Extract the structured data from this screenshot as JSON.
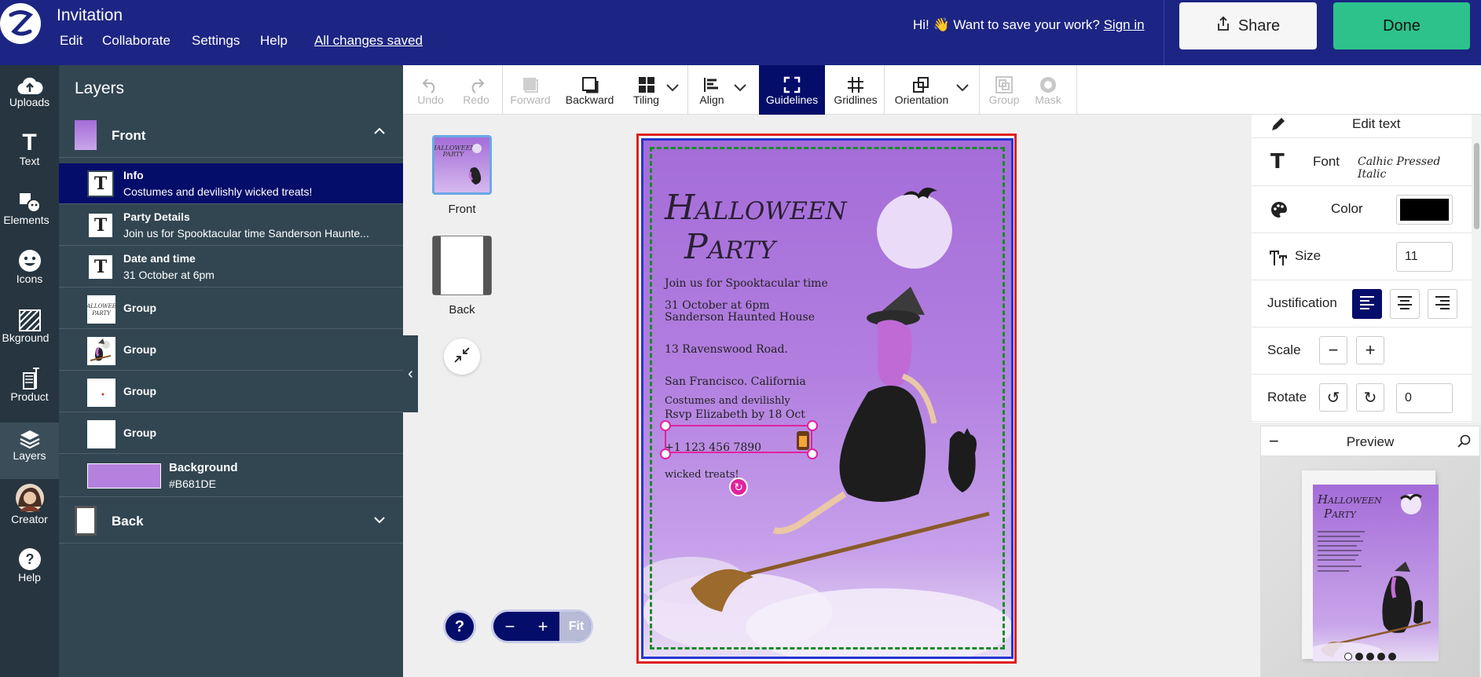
{
  "app": {
    "title": "Invitation",
    "menu": [
      "Edit",
      "Collaborate",
      "Settings",
      "Help"
    ],
    "saved_status": "All changes saved",
    "greeting": "Hi! 👋 Want to save your work?",
    "sign_in": "Sign in",
    "share_label": "Share",
    "done_label": "Done"
  },
  "left_nav": {
    "items": [
      {
        "label": "Uploads",
        "icon": "cloud-upload-icon"
      },
      {
        "label": "Text",
        "icon": "text-icon"
      },
      {
        "label": "Elements",
        "icon": "shapes-icon"
      },
      {
        "label": "Icons",
        "icon": "smiley-icon"
      },
      {
        "label": "Bkground",
        "icon": "hatch-icon"
      },
      {
        "label": "Product",
        "icon": "product-icon"
      },
      {
        "label": "Layers",
        "icon": "layers-icon"
      },
      {
        "label": "Creator",
        "icon": "avatar-icon"
      },
      {
        "label": "Help",
        "icon": "help-icon"
      }
    ],
    "active": "Layers"
  },
  "layers_panel": {
    "title": "Layers",
    "front_label": "Front",
    "back_label": "Back",
    "items": [
      {
        "name": "Info",
        "sub": "Costumes and devilishly wicked treats!",
        "kind": "text",
        "selected": true
      },
      {
        "name": "Party Details",
        "sub": "Join us for Spooktacular time Sanderson Haunte...",
        "kind": "text"
      },
      {
        "name": "Date and time",
        "sub": "31 October at 6pm",
        "kind": "text"
      },
      {
        "name": "Group",
        "sub": "",
        "kind": "group-title"
      },
      {
        "name": "Group",
        "sub": "",
        "kind": "group-witch"
      },
      {
        "name": "Group",
        "sub": "",
        "kind": "group-small"
      },
      {
        "name": "Group",
        "sub": "",
        "kind": "group-blank"
      }
    ],
    "background": {
      "name": "Background",
      "sub": "#B681DE",
      "color": "#B681DE"
    }
  },
  "toolbar": {
    "tools": [
      {
        "label": "Undo",
        "icon": "undo-icon",
        "disabled": true
      },
      {
        "label": "Redo",
        "icon": "redo-icon",
        "disabled": true
      },
      {
        "label": "Forward",
        "icon": "forward-icon",
        "disabled": true
      },
      {
        "label": "Backward",
        "icon": "backward-icon",
        "disabled": false
      },
      {
        "label": "Tiling",
        "icon": "tiling-icon",
        "disabled": false
      },
      {
        "label": "Align",
        "icon": "align-icon",
        "disabled": false
      },
      {
        "label": "Guidelines",
        "icon": "guidelines-icon",
        "active": true
      },
      {
        "label": "Gridlines",
        "icon": "grid-icon",
        "disabled": false
      },
      {
        "label": "Orientation",
        "icon": "orientation-icon",
        "disabled": false
      },
      {
        "label": "Group",
        "icon": "group-icon",
        "disabled": true
      },
      {
        "label": "Mask",
        "icon": "mask-icon",
        "disabled": true
      }
    ]
  },
  "pages": [
    {
      "label": "Front",
      "selected": true
    },
    {
      "label": "Back",
      "selected": false
    }
  ],
  "zoom": {
    "minus": "−",
    "plus": "+",
    "fit": "Fit",
    "help": "?"
  },
  "card": {
    "title_line1": "Halloween",
    "title_line2": "Party",
    "lines": [
      "Join us for Spooktacular time",
      "31 October at 6pm",
      "Sanderson Haunted House",
      "13 Ravenswood Road.",
      "San Francisco. California",
      "Costumes and devilishly",
      "Rsvp Elizabeth by 18 Oct",
      "+1 123 456 7890",
      "wicked treats!"
    ],
    "background_color": "#B681DE"
  },
  "properties": {
    "edit_text": "Edit text",
    "font_label": "Font",
    "font_value": "Calhic Pressed Italic",
    "color_label": "Color",
    "color_value": "#000000",
    "size_label": "Size",
    "size_value": "11",
    "justification_label": "Justification",
    "scale_label": "Scale",
    "rotate_label": "Rotate",
    "rotate_value": "0"
  },
  "preview": {
    "title": "Preview",
    "card_title_line1": "Halloween",
    "card_title_line2": "Party",
    "dots": 5,
    "active_dot": 0
  }
}
